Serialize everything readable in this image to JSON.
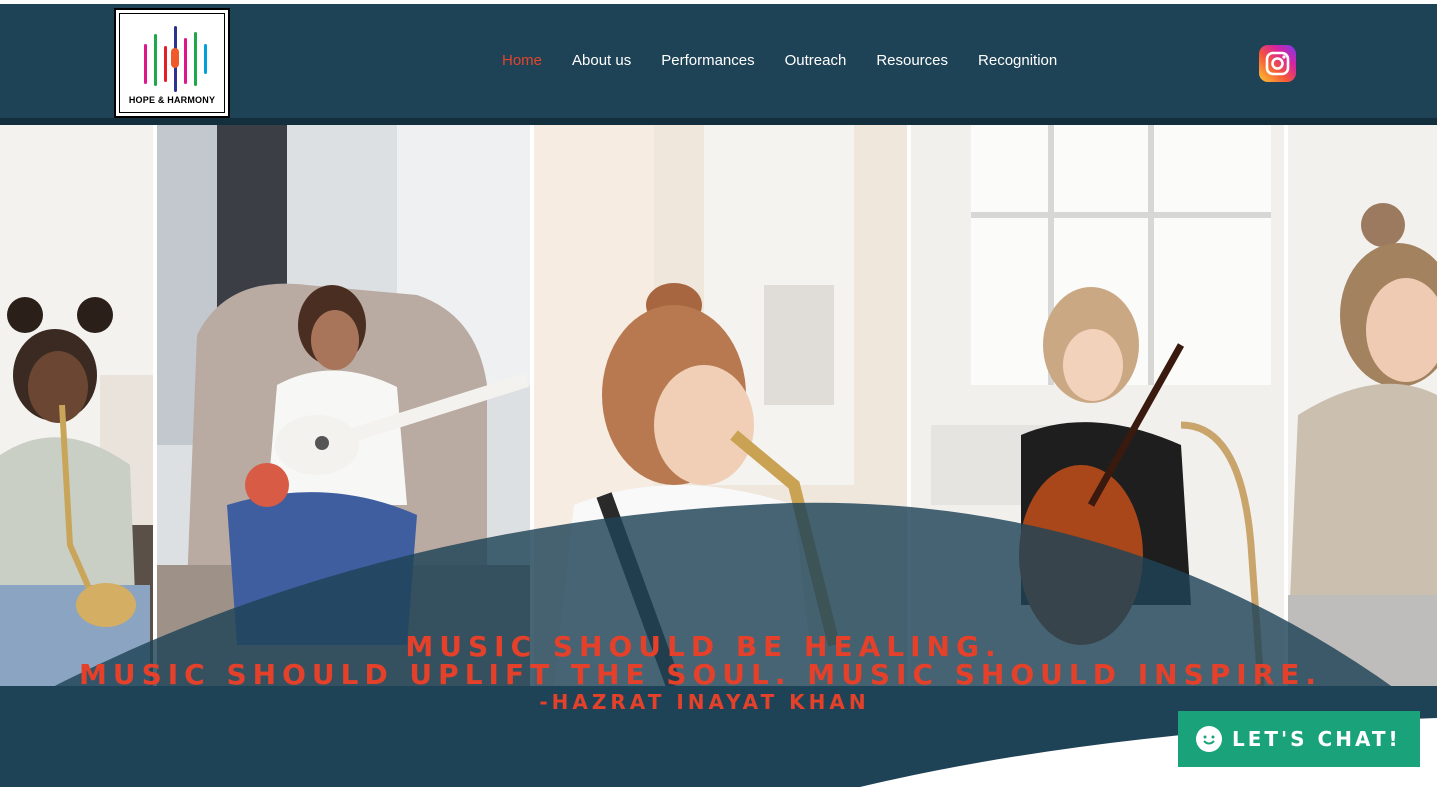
{
  "brand": {
    "logo_text": "HOPE & HARMONY",
    "bar_colors": [
      "#e0158a",
      "#1ea84a",
      "#f05a28",
      "#2e3192",
      "#00a0dc",
      "#e31e24"
    ]
  },
  "nav": {
    "items": [
      {
        "label": "Home",
        "active": true
      },
      {
        "label": "About us",
        "active": false
      },
      {
        "label": "Performances",
        "active": false
      },
      {
        "label": "Outreach",
        "active": false
      },
      {
        "label": "Resources",
        "active": false
      },
      {
        "label": "Recognition",
        "active": false
      }
    ]
  },
  "social": {
    "icon": "instagram-icon"
  },
  "gallery": {
    "panels": [
      "trumpet-player",
      "ukulele-player",
      "saxophone-player",
      "cello-player",
      "smiling-girl"
    ]
  },
  "quote": {
    "line1": "Music should be healing.",
    "line2": "Music should uplift the soul. Music should inspire.",
    "author": "-Hazrat Inayat Khan"
  },
  "chat": {
    "label": "LET'S CHAT!"
  },
  "colors": {
    "header": "#1e4357",
    "accent": "#e5412a",
    "chat": "#1aa37a"
  }
}
